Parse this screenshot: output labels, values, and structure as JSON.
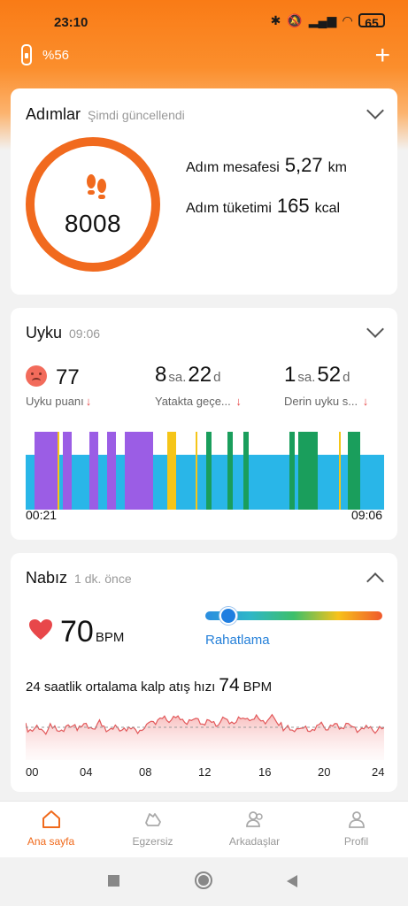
{
  "status_bar": {
    "time": "23:10",
    "battery": "65"
  },
  "band": {
    "battery_text": "%56"
  },
  "steps_card": {
    "title": "Adımlar",
    "subtitle": "Şimdi güncellendi",
    "steps": "8008",
    "distance_label": "Adım mesafesi",
    "distance_value": "5,27",
    "distance_unit": "km",
    "calories_label": "Adım tüketimi",
    "calories_value": "165",
    "calories_unit": "kcal"
  },
  "sleep_card": {
    "title": "Uyku",
    "subtitle": "09:06",
    "score": "77",
    "score_label": "Uyku puanı",
    "bed_hours": "8",
    "bed_minutes": "22",
    "bed_label": "Yatakta geçe...",
    "deep_hours": "1",
    "deep_minutes": "52",
    "deep_label": "Derin uyku s...",
    "hour_unit": "sa.",
    "minute_unit": "d",
    "start_time": "00:21",
    "end_time": "09:06",
    "colors": {
      "light": "#29b6e8",
      "rem": "#9b5de5",
      "awake": "#f5c518",
      "deep": "#1a9e5c"
    }
  },
  "heart_card": {
    "title": "Nabız",
    "subtitle": "1 dk. önce",
    "bpm": "70",
    "bpm_unit": "BPM",
    "zone": "Rahatlama",
    "avg_label": "24 saatlik ortalama kalp atış hızı",
    "avg_value": "74",
    "avg_unit": "BPM",
    "x_ticks": [
      "00",
      "04",
      "08",
      "12",
      "16",
      "20",
      "24"
    ]
  },
  "nav": {
    "items": [
      {
        "label": "Ana sayfa",
        "icon": "home-icon"
      },
      {
        "label": "Egzersiz",
        "icon": "shoe-icon"
      },
      {
        "label": "Arkadaşlar",
        "icon": "friends-icon"
      },
      {
        "label": "Profil",
        "icon": "profile-icon"
      }
    ],
    "active_color": "#f06a1c"
  }
}
